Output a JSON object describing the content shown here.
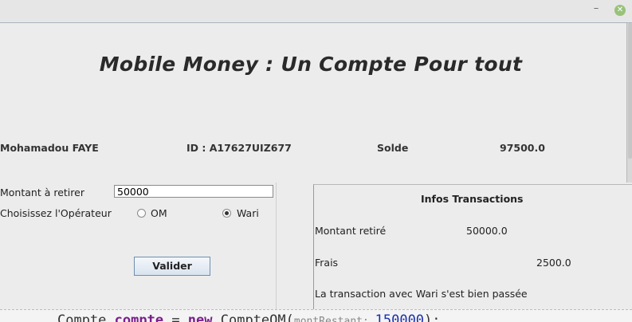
{
  "window": {
    "minimize_glyph": "–",
    "close_glyph": "✕",
    "close_color": "#98c27a"
  },
  "header": {
    "title": "Mobile Money : Un Compte Pour tout"
  },
  "account": {
    "name": "Mohamadou FAYE",
    "id_text": "ID : A17627UIZ677",
    "balance_label": "Solde",
    "balance_value": "97500.0"
  },
  "form": {
    "amount_label": "Montant à retirer",
    "amount_value": "50000",
    "operator_label": "Choisissez l'Opérateur",
    "operators": [
      {
        "label": "OM",
        "selected": false
      },
      {
        "label": "Wari",
        "selected": true
      }
    ],
    "submit_label": "Valider"
  },
  "transactions": {
    "title": "Infos Transactions",
    "withdrawn_label": "Montant retiré",
    "withdrawn_value": "50000.0",
    "fees_label": "Frais",
    "fees_value": "2500.0",
    "message": "La transaction avec Wari s'est bien passée"
  },
  "background_editor": {
    "code_part1": "Compte ",
    "code_var": "compte",
    "code_part2": " = ",
    "code_new": "new",
    "code_part3": " CompteOM(",
    "code_hint": "montRestant: ",
    "code_num": "150000",
    "code_end": ");"
  }
}
